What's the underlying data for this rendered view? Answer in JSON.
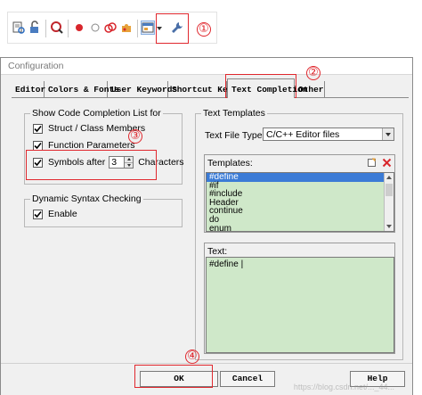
{
  "annotations": {
    "colors": {
      "red": "#e0282e"
    },
    "n1": "①",
    "n2": "②",
    "n3": "③",
    "n4": "④"
  },
  "toolbar": {
    "icons": [
      "find-in-files-icon",
      "lock-icon",
      "zoom-search-icon",
      "record-macro-icon",
      "circle-outline-icon",
      "marker-icon",
      "puzzle-icon",
      "window-layout-icon",
      "wrench-icon"
    ]
  },
  "dialog": {
    "title": "Configuration",
    "tabs": [
      {
        "label": "Editor"
      },
      {
        "label": "Colors & Fonts"
      },
      {
        "label": "User Keywords"
      },
      {
        "label": "Shortcut Keys"
      },
      {
        "label": "Text Completion"
      },
      {
        "label": "Other"
      }
    ],
    "active_tab": "Text Completion",
    "code_completion": {
      "title": "Show Code Completion List for",
      "struct_label": "Struct / Class Members",
      "function_label": "Function Parameters",
      "symbols_label": "Symbols after",
      "symbols_value": "3",
      "characters_label": "Characters"
    },
    "syntax_checking": {
      "title": "Dynamic Syntax Checking",
      "enable_label": "Enable"
    },
    "text_templates": {
      "title": "Text Templates",
      "file_types_label": "Text File Types:",
      "file_type_value": "C/C++ Editor files",
      "templates_label": "Templates:",
      "templates": [
        "#define",
        "#if",
        "#include",
        "Header",
        "continue",
        "do",
        "enum"
      ],
      "text_label": "Text:",
      "text_value": "#define |"
    },
    "buttons": {
      "ok": "OK",
      "cancel": "Cancel",
      "help": "Help"
    },
    "watermark": "https://blog.csdn.net/..._44..."
  }
}
